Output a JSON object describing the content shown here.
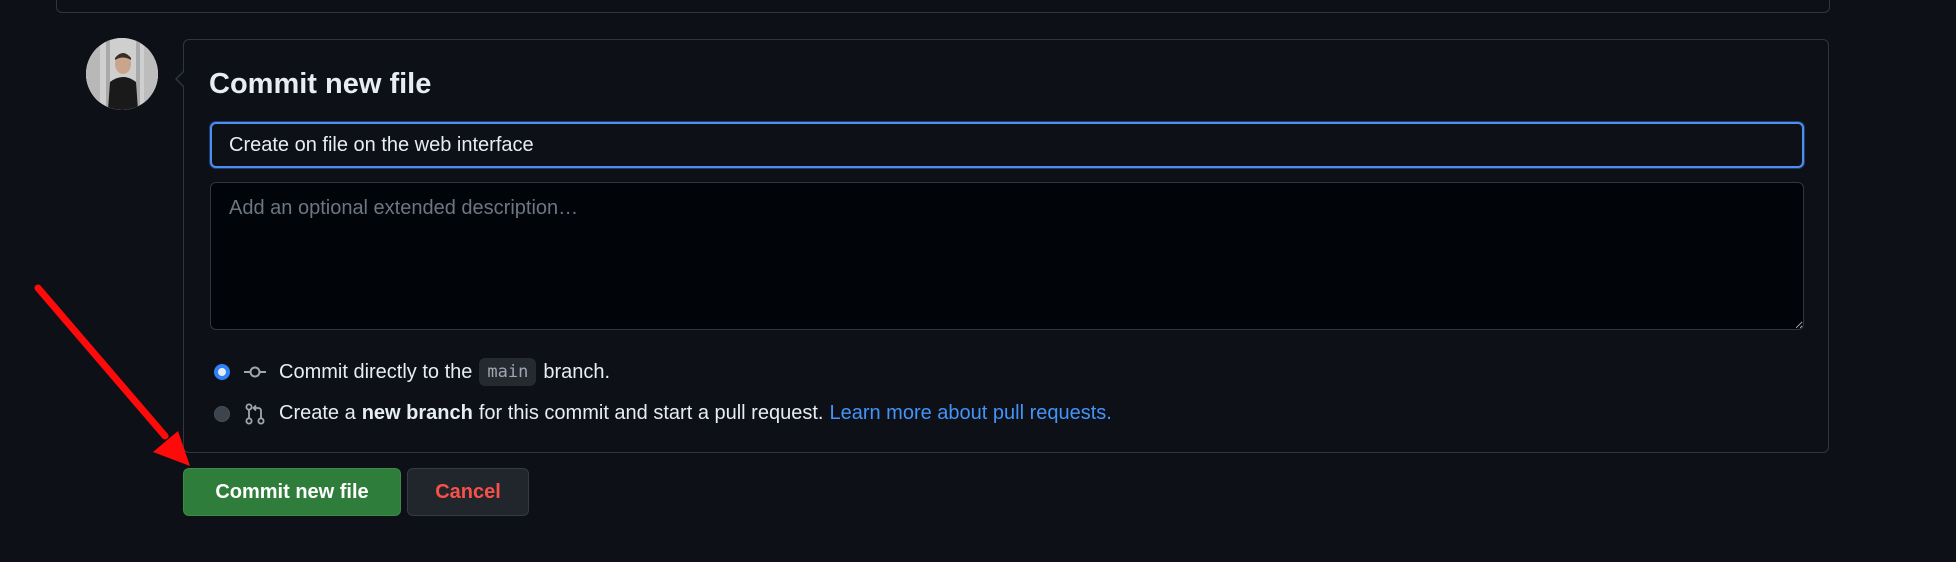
{
  "commit_form": {
    "title": "Commit new file",
    "summary_value": "Create on file on the web interface",
    "description_placeholder": "Add an optional extended description…",
    "options": {
      "direct": {
        "prefix": "Commit directly to the",
        "branch": "main",
        "suffix": "branch.",
        "selected": true,
        "icon": "git-commit-icon"
      },
      "new_branch": {
        "prefix": "Create a",
        "bold": "new branch",
        "suffix": "for this commit and start a pull request.",
        "link": "Learn more about pull requests.",
        "selected": false,
        "icon": "git-pull-request-icon"
      }
    }
  },
  "actions": {
    "commit_label": "Commit new file",
    "cancel_label": "Cancel"
  },
  "colors": {
    "background": "#0d1117",
    "primary_button": "#2f7d3b",
    "cancel_text": "#f85149",
    "link": "#4493f8",
    "focus_border": "#4d8ef0",
    "annotation_arrow": "#ff0000"
  }
}
